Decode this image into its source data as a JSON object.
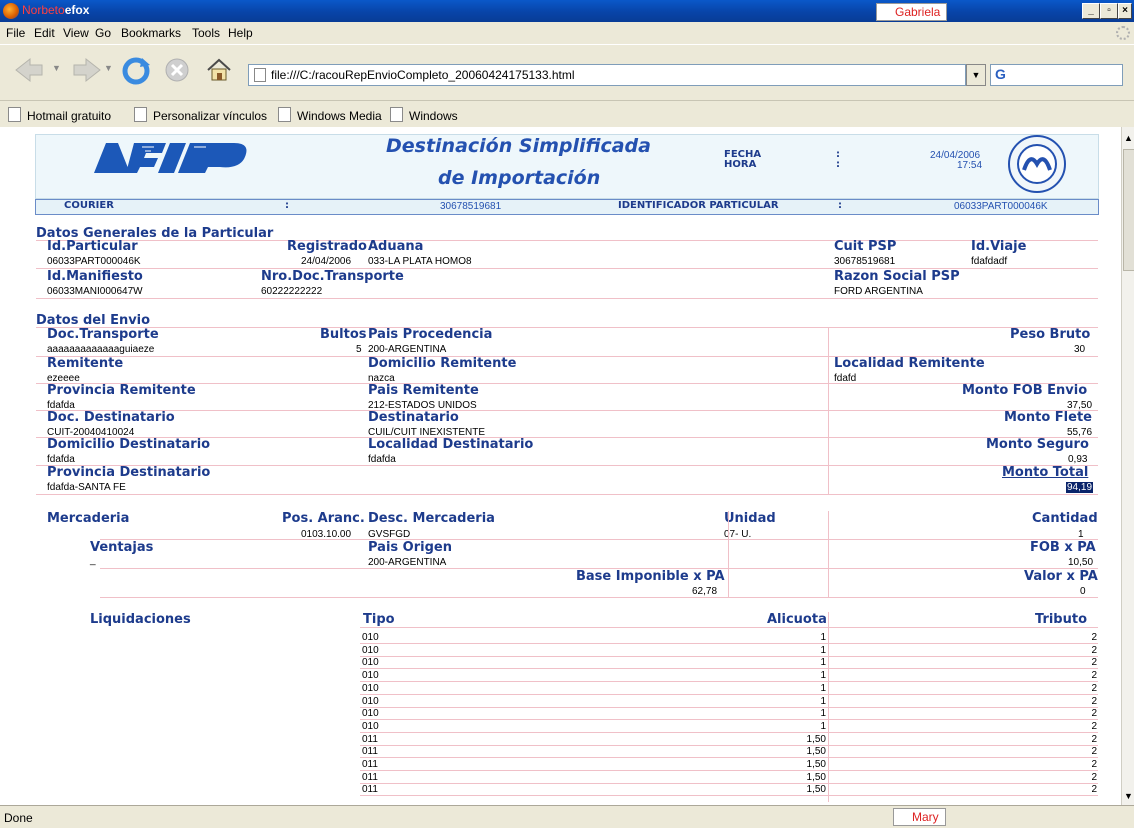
{
  "window": {
    "title_user": "Norbeto",
    "title_app": "efox",
    "badge_top": "Gabriela",
    "badge_bottom": "Mary"
  },
  "menu": [
    "File",
    "Edit",
    "View",
    "Go",
    "Bookmarks",
    "Tools",
    "Help"
  ],
  "address": "file:///C:/racouRepEnvioCompleto_20060424175133.html",
  "bookmarks": [
    "Hotmail gratuito",
    "Personalizar vínculos",
    "Windows Media",
    "Windows"
  ],
  "status": "Done",
  "doc": {
    "logo": "AFIP",
    "title1": "Destinación Simplificada",
    "title2": "de Importación",
    "fecha_label": "FECHA",
    "hora_label": "HORA",
    "colon": ":",
    "fecha": "24/04/2006",
    "hora": "17:54",
    "courier_label": "COURIER",
    "courier": "30678519681",
    "idpart_label": "IDENTIFICADOR PARTICULAR",
    "idpart": "06033PART000046K",
    "sec1": "Datos Generales de la Particular",
    "id_particular_l": "Id.Particular",
    "id_particular": "06033PART000046K",
    "registrado_l": "Registrado",
    "registrado": "24/04/2006",
    "aduana_l": "Aduana",
    "aduana": "033-LA PLATA HOMO8",
    "cuit_psp_l": "Cuit PSP",
    "cuit_psp": "30678519681",
    "id_viaje_l": "Id.Viaje",
    "id_viaje": "fdafdadf",
    "id_manifiesto_l": "Id.Manifiesto",
    "id_manifiesto": "06033MANI000647W",
    "nro_doc_l": "Nro.Doc.Transporte",
    "nro_doc": "60222222222",
    "razon_l": "Razon Social PSP",
    "razon": "FORD ARGENTINA",
    "sec2": "Datos del Envio",
    "doc_transporte_l": "Doc.Transporte",
    "doc_transporte": "aaaaaaaaaaaaaguiaeze",
    "bultos_l": "Bultos",
    "bultos": "5",
    "pais_proc_l": "Pais Procedencia",
    "pais_proc": "200-ARGENTINA",
    "peso_l": "Peso Bruto",
    "peso": "30",
    "remitente_l": "Remitente",
    "remitente": "ezeeee",
    "dom_rem_l": "Domicilio Remitente",
    "dom_rem": "nazca",
    "loc_rem_l": "Localidad Remitente",
    "loc_rem": "fdafd",
    "prov_rem_l": "Provincia Remitente",
    "prov_rem": "fdafda",
    "pais_rem_l": "Pais Remitente",
    "pais_rem": "212-ESTADOS UNIDOS",
    "fob_env_l": "Monto FOB Envio",
    "fob_env": "37,50",
    "doc_dest_l": "Doc. Destinatario",
    "doc_dest": "CUIT-20040410024",
    "dest_l": "Destinatario",
    "dest": "CUIL/CUIT INEXISTENTE",
    "flete_l": "Monto Flete",
    "flete": "55,76",
    "dom_dest_l": "Domicilio Destinatario",
    "dom_dest": "fdafda",
    "loc_dest_l": "Localidad Destinatario",
    "loc_dest": "fdafda",
    "seguro_l": "Monto Seguro",
    "seguro": "0,93",
    "prov_dest_l": "Provincia Destinatario",
    "prov_dest": "fdafda-SANTA FE",
    "total_l": "Monto Total",
    "total": "94,19",
    "merc_l": "Mercaderia",
    "pos_l": "Pos. Aranc.",
    "pos": "0103.10.00",
    "desc_l": "Desc. Mercaderia",
    "desc": "GVSFGD",
    "unidad_l": "Unidad",
    "unidad": "07- U.",
    "cantidad_l": "Cantidad",
    "cantidad": "1",
    "ventajas_l": "Ventajas",
    "ventajas": "_",
    "pais_orig_l": "Pais Origen",
    "pais_orig": "200-ARGENTINA",
    "fobpa_l": "FOB x PA",
    "fobpa": "10,50",
    "base_l": "Base Imponible x PA",
    "base": "62,78",
    "valorpa_l": "Valor x PA",
    "valorpa": "0",
    "liq_l": "Liquidaciones",
    "tipo_l": "Tipo",
    "alic_l": "Alicuota",
    "trib_l": "Tributo",
    "liq_rows": [
      {
        "tipo": "010",
        "alic": "1",
        "trib": "2"
      },
      {
        "tipo": "010",
        "alic": "1",
        "trib": "2"
      },
      {
        "tipo": "010",
        "alic": "1",
        "trib": "2"
      },
      {
        "tipo": "010",
        "alic": "1",
        "trib": "2"
      },
      {
        "tipo": "010",
        "alic": "1",
        "trib": "2"
      },
      {
        "tipo": "010",
        "alic": "1",
        "trib": "2"
      },
      {
        "tipo": "010",
        "alic": "1",
        "trib": "2"
      },
      {
        "tipo": "010",
        "alic": "1",
        "trib": "2"
      },
      {
        "tipo": "011",
        "alic": "1,50",
        "trib": "2"
      },
      {
        "tipo": "011",
        "alic": "1,50",
        "trib": "2"
      },
      {
        "tipo": "011",
        "alic": "1,50",
        "trib": "2"
      },
      {
        "tipo": "011",
        "alic": "1,50",
        "trib": "2"
      },
      {
        "tipo": "011",
        "alic": "1,50",
        "trib": "2"
      }
    ]
  }
}
